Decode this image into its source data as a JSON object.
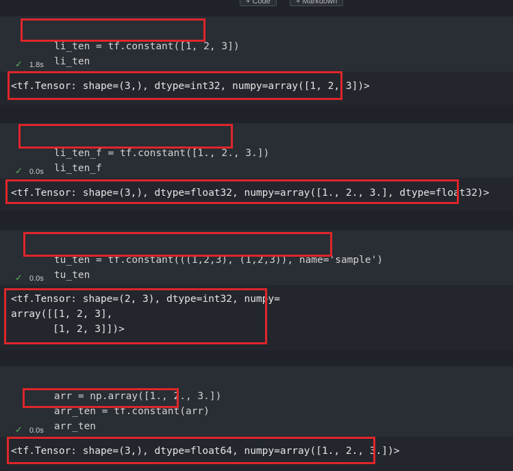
{
  "toolbar": {
    "code_label": "+ Code",
    "markdown_label": "+ Markdown"
  },
  "cells": [
    {
      "code": [
        "li_ten = tf.constant([1, 2, 3])",
        "li_ten"
      ],
      "status": "1.8s",
      "output": [
        "<tf.Tensor: shape=(3,), dtype=int32, numpy=array([1, 2, 3])>"
      ]
    },
    {
      "code": [
        "li_ten_f = tf.constant([1., 2., 3.])",
        "li_ten_f"
      ],
      "status": "0.0s",
      "output": [
        "<tf.Tensor: shape=(3,), dtype=float32, numpy=array([1., 2., 3.], dtype=float32)>"
      ]
    },
    {
      "code": [
        "tu_ten = tf.constant(((1,2,3), (1,2,3)), name='sample')",
        "tu_ten"
      ],
      "status": "0.0s",
      "output": [
        "<tf.Tensor: shape=(2, 3), dtype=int32, numpy=",
        "array([[1, 2, 3],",
        "       [1, 2, 3]])>"
      ]
    },
    {
      "code": [
        "arr = np.array([1., 2., 3.])",
        "arr_ten = tf.constant(arr)",
        "arr_ten"
      ],
      "status": "0.0s",
      "output": [
        "<tf.Tensor: shape=(3,), dtype=float64, numpy=array([1., 2., 3.])>"
      ]
    }
  ],
  "icons": {
    "success": "check-icon"
  },
  "colors": {
    "background": "#1f2329",
    "cell_background": "#292d34",
    "output_background": "#23272d",
    "highlight_box": "#e0262a",
    "success_check": "#5fb85f"
  }
}
